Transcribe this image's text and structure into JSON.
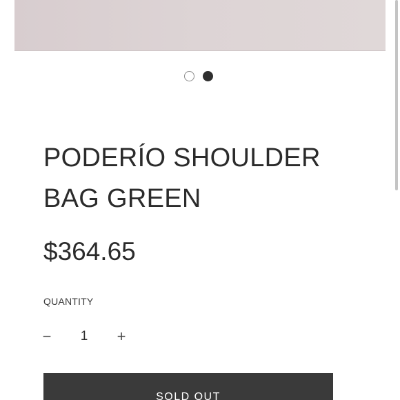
{
  "gallery": {
    "image_color": "#dcd2d3",
    "dots": [
      {
        "state": "inactive"
      },
      {
        "state": "active"
      }
    ],
    "active_index": 1
  },
  "product": {
    "title": "PODERÍO SHOULDER BAG GREEN",
    "price": "$364.65"
  },
  "quantity": {
    "label": "QUANTITY",
    "value": "1",
    "decrease_symbol": "−",
    "increase_symbol": "+"
  },
  "actions": {
    "sold_out_label": "SOLD OUT"
  },
  "colors": {
    "text": "#2b2b2b",
    "button_bg": "#3a3a3a",
    "button_text": "#ffffff",
    "dot_active": "#2f2f2f"
  }
}
